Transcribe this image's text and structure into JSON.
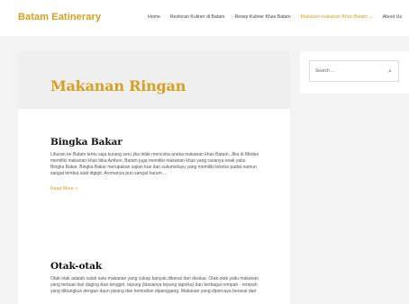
{
  "header": {
    "brand": "Batam Eatinerary",
    "nav": [
      {
        "label": "Home"
      },
      {
        "label": "Restoran Kuliner di Batam"
      },
      {
        "label": "Resep Kuliner Khas Batam"
      },
      {
        "label": "Makanan-makanan Khas Batam",
        "active": true,
        "dropdown": true
      },
      {
        "label": "About Us"
      }
    ]
  },
  "page": {
    "title": "Makanan Ringan",
    "posts": [
      {
        "title": "Bingka Bakar",
        "excerpt": "Liburan ke Batam tentu saja kurang seru jika tidak mencoba aneka makanan khas Batam. Jika di Medan memiliki makanan khas bika Ambon, Batam juga memiliki makanan khas yang rasanya enak yaitu Bingka Bakar. Bingka Bakar merupakan sajian kue dari sukumelayu yang memiliki tekstur padat namun sangat lembut saat digigit. Aromanya pun sangat harum ...",
        "read_more": "Read More »"
      },
      {
        "title": "Otak-otak",
        "excerpt": "Otak-otak adalah salah satu makanan yang cukup banyak dikenal dan disukai. Otak-otak yaitu makanan yang terbuat dari daging ikan tenggiri, tepung (biasanya tepung tapioka) dan berbagai rempah - rempah yang dibungkus dengan daun pisang dan kemudian dipanggang. Makanan yang dipercaya berasal dari"
      }
    ]
  },
  "sidebar": {
    "search_placeholder": "Search ...",
    "search_icon": "search-icon"
  },
  "colors": {
    "accent": "#d7a01d",
    "text": "#111111"
  }
}
